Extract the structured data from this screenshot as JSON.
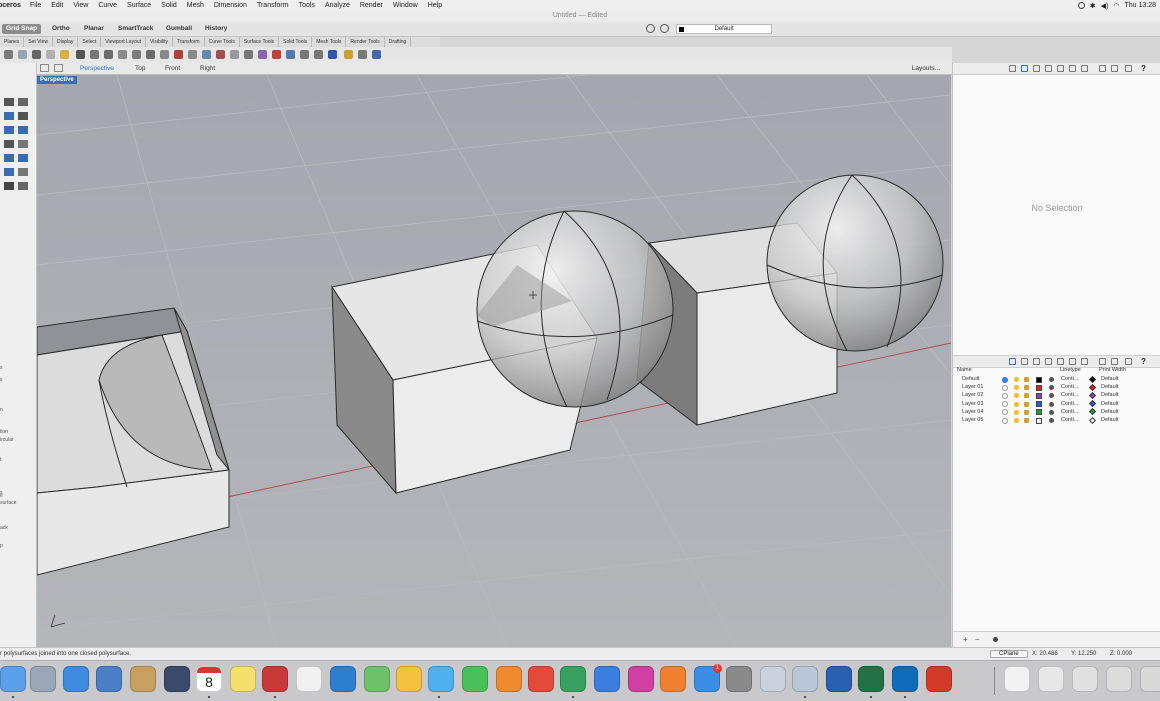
{
  "menubar": {
    "app_name": "oceros",
    "items": [
      "File",
      "Edit",
      "View",
      "Curve",
      "Surface",
      "Solid",
      "Mesh",
      "Dimension",
      "Transform",
      "Tools",
      "Analyze",
      "Render",
      "Window",
      "Help"
    ],
    "clock": "Thu 13:28"
  },
  "window": {
    "title": "Untitled — Edited"
  },
  "modebar": {
    "items": [
      "Grid Snap",
      "Ortho",
      "Planar",
      "SmartTrack",
      "Gumball",
      "History"
    ],
    "active": "Grid Snap",
    "current_layer": "Default"
  },
  "toolbar_tabs": [
    "Planes",
    "Set View",
    "Display",
    "Select",
    "Viewport Layout",
    "Visibility",
    "Transform",
    "Curve Tools",
    "Surface Tools",
    "Solid Tools",
    "Mesh Tools",
    "Render Tools",
    "Drafting"
  ],
  "viewport_tabs": {
    "items": [
      "Perspective",
      "Top",
      "Front",
      "Right"
    ],
    "active": "Perspective",
    "layouts": "Layouts..."
  },
  "viewport": {
    "label": "Perspective"
  },
  "left_command_fragments": [
    "s",
    "s",
    "n",
    "tion",
    "ircular",
    "t",
    "s",
    "e",
    "surface",
    "ack",
    "p"
  ],
  "properties": {
    "empty_text": "No Selection"
  },
  "layers": {
    "columns": {
      "name": "Name",
      "linetype": "Linetype",
      "print_width": "Print Width"
    },
    "rows": [
      {
        "name": "Default",
        "color": "#000000",
        "linetype": "Conti...",
        "print_color": "#000000",
        "print_width": "Default",
        "current": true
      },
      {
        "name": "Layer 01",
        "color": "#e02020",
        "linetype": "Conti...",
        "print_color": "#e02020",
        "print_width": "Default",
        "current": false
      },
      {
        "name": "Layer 02",
        "color": "#8a3fd0",
        "linetype": "Conti...",
        "print_color": "#8a3fd0",
        "print_width": "Default",
        "current": false
      },
      {
        "name": "Layer 03",
        "color": "#2060e0",
        "linetype": "Conti...",
        "print_color": "#2060e0",
        "print_width": "Default",
        "current": false
      },
      {
        "name": "Layer 04",
        "color": "#20a030",
        "linetype": "Conti...",
        "print_color": "#20a030",
        "print_width": "Default",
        "current": false
      },
      {
        "name": "Layer 05",
        "color": "#ffffff",
        "linetype": "Conti...",
        "print_color": "#ffffff",
        "print_width": "Default",
        "current": false
      }
    ]
  },
  "status": {
    "message": "r polysurfaces joined into one closed polysurface.",
    "cplane": "CPlane",
    "x": "X: 20.486",
    "y": "Y: 12.250",
    "z": "Z: 0.000"
  },
  "dock": {
    "apps": [
      "finder-app",
      "launchpad-app",
      "safari-app",
      "preview-app",
      "contacts-app",
      "quicktime-app",
      "calendar-app",
      "notes-app",
      "photo-booth-app",
      "reminders-app",
      "vectorworks-app",
      "maps-app",
      "photos-app",
      "messages-app",
      "facetime-app",
      "pages-app",
      "chrome-app",
      "numbers-app",
      "keynote-app",
      "itunes-app",
      "ibooks-app",
      "app-store-app",
      "system-preferences-app",
      "preview2-app",
      "photo-app",
      "word-app",
      "excel-app",
      "outlook-app",
      "acrobat-app",
      "doc1-app",
      "doc2-app",
      "doc3-app",
      "doc4-app",
      "trash-app"
    ],
    "calendar_day": "8",
    "appstore_badge": "1"
  }
}
